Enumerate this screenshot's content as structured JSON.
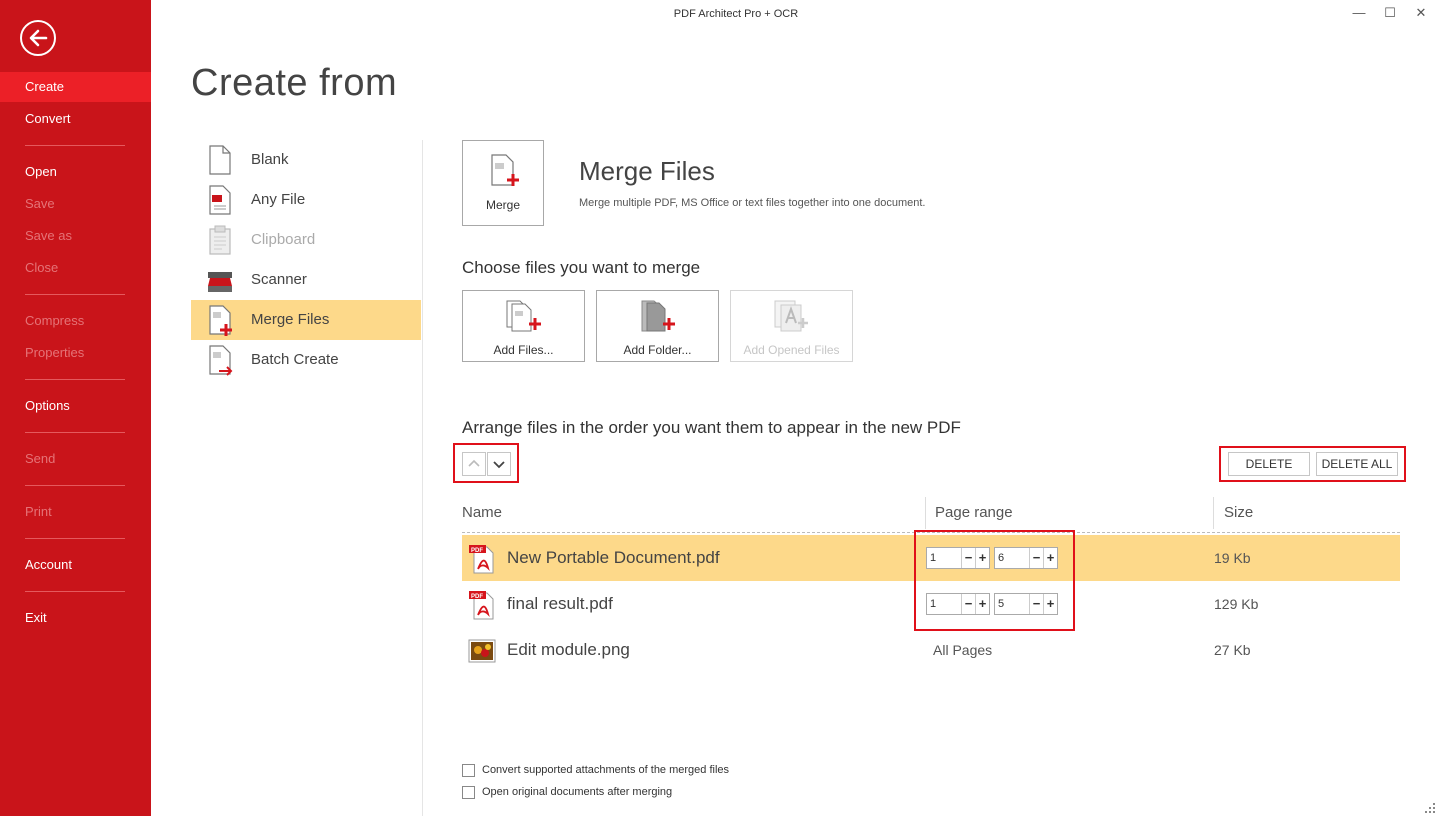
{
  "app": {
    "title": "PDF Architect Pro + OCR"
  },
  "window_controls": {
    "minimize": "—",
    "maximize": "☐",
    "close": "✕"
  },
  "sidebar": {
    "items": [
      {
        "label": "Create",
        "active": true
      },
      {
        "label": "Convert"
      },
      {
        "label": "Open"
      },
      {
        "label": "Save",
        "disabled": true
      },
      {
        "label": "Save as",
        "disabled": true
      },
      {
        "label": "Close",
        "disabled": true
      },
      {
        "label": "Compress",
        "disabled": true
      },
      {
        "label": "Properties",
        "disabled": true
      },
      {
        "label": "Options"
      },
      {
        "label": "Send",
        "disabled": true
      },
      {
        "label": "Print",
        "disabled": true
      },
      {
        "label": "Account"
      },
      {
        "label": "Exit"
      }
    ]
  },
  "page": {
    "title": "Create from"
  },
  "sources": [
    {
      "label": "Blank",
      "icon": "blank-page-icon"
    },
    {
      "label": "Any File",
      "icon": "any-file-icon"
    },
    {
      "label": "Clipboard",
      "icon": "clipboard-icon",
      "disabled": true
    },
    {
      "label": "Scanner",
      "icon": "scanner-icon"
    },
    {
      "label": "Merge Files",
      "icon": "merge-files-icon",
      "active": true
    },
    {
      "label": "Batch Create",
      "icon": "batch-create-icon"
    }
  ],
  "merge": {
    "tile_label": "Merge",
    "title": "Merge Files",
    "description": "Merge multiple PDF, MS Office or text files together into one document."
  },
  "choose": {
    "heading": "Choose files you want to merge",
    "add_files": "Add Files...",
    "add_folder": "Add Folder...",
    "add_opened": "Add Opened Files"
  },
  "arrange": {
    "heading": "Arrange files in the order you want them to appear in the new PDF",
    "delete": "DELETE",
    "delete_all": "DELETE ALL"
  },
  "table": {
    "columns": [
      "Name",
      "Page range",
      "Size"
    ],
    "rows": [
      {
        "name": "New Portable Document.pdf",
        "type": "pdf",
        "from": "1",
        "to": "6",
        "size": "19 Kb",
        "selected": true
      },
      {
        "name": "final result.pdf",
        "type": "pdf",
        "from": "1",
        "to": "5",
        "size": "129 Kb"
      },
      {
        "name": "Edit module.png",
        "type": "png",
        "range_text": "All Pages",
        "size": "27 Kb"
      }
    ]
  },
  "options": {
    "convert_attachments": "Convert supported attachments of the merged files",
    "open_after": "Open original documents after merging"
  },
  "colors": {
    "sidebar": "#c9141a",
    "active_nav": "#ec2027",
    "selection": "#fdd98a",
    "highlight_box": "#e0101a"
  }
}
